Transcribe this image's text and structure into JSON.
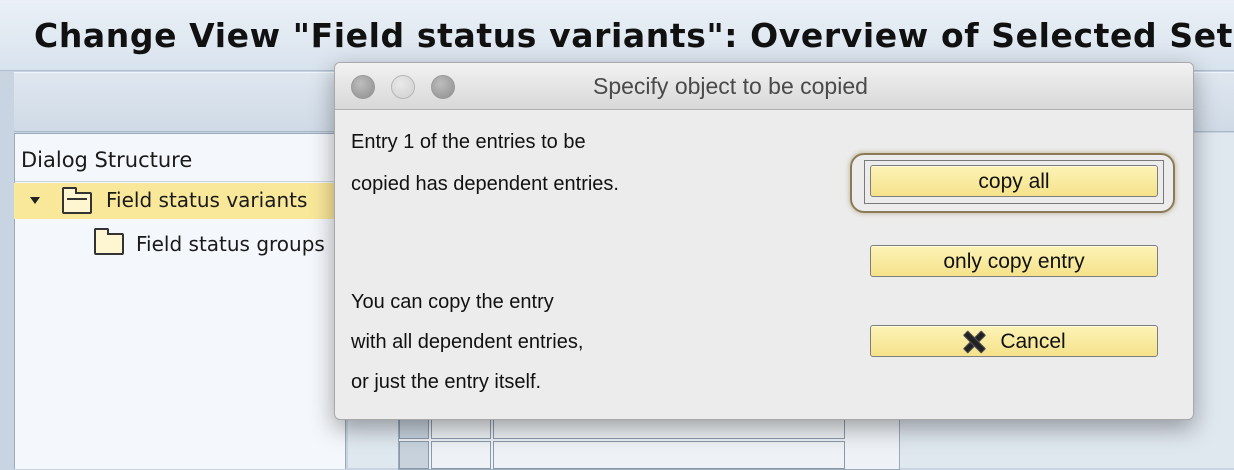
{
  "window": {
    "title": "Change View \"Field status variants\": Overview of Selected Set"
  },
  "left_panel": {
    "title": "Dialog Structure",
    "tree": [
      {
        "label": "Field status variants",
        "selected": true,
        "expanded": true,
        "icon": "folder-open-icon"
      },
      {
        "label": "Field status groups",
        "selected": false,
        "expanded": false,
        "icon": "folder-icon"
      }
    ]
  },
  "dialog": {
    "title": "Specify object to be copied",
    "message_lines": [
      "Entry  1  of the entries to be",
      "copied has dependent entries."
    ],
    "info_lines": [
      "You can copy the entry",
      "with all dependent entries,",
      "or just the entry itself."
    ],
    "buttons": {
      "copy_all": "copy all",
      "only_copy_entry": "only copy entry",
      "cancel": "Cancel"
    }
  },
  "colors": {
    "button_fill": "#f5e28a",
    "selected_row": "#f9e89a",
    "background": "#c8d4e1"
  }
}
